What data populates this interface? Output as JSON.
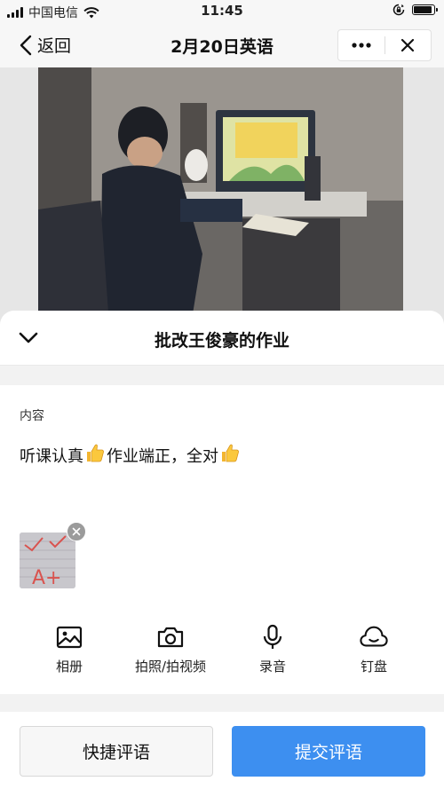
{
  "status_bar": {
    "carrier": "中国电信",
    "time": "11:45",
    "battery_level": 0.92
  },
  "nav": {
    "back_label": "返回",
    "title": "2月20日英语"
  },
  "sheet": {
    "title": "批改王俊豪的作业",
    "content_label": "内容",
    "comment_segments": [
      "听课认真",
      "👍",
      "作业端正，全对",
      "👍"
    ],
    "attachment_mark": "A+"
  },
  "tools": [
    {
      "icon": "photo-album-icon",
      "label": "相册"
    },
    {
      "icon": "camera-icon",
      "label": "拍照/拍视频"
    },
    {
      "icon": "microphone-icon",
      "label": "录音"
    },
    {
      "icon": "cloud-drive-icon",
      "label": "钉盘"
    }
  ],
  "buttons": {
    "quick_label": "快捷评语",
    "submit_label": "提交评语"
  },
  "colors": {
    "accent": "#3d8ff0",
    "sheet_bg": "#f2f2f2"
  }
}
